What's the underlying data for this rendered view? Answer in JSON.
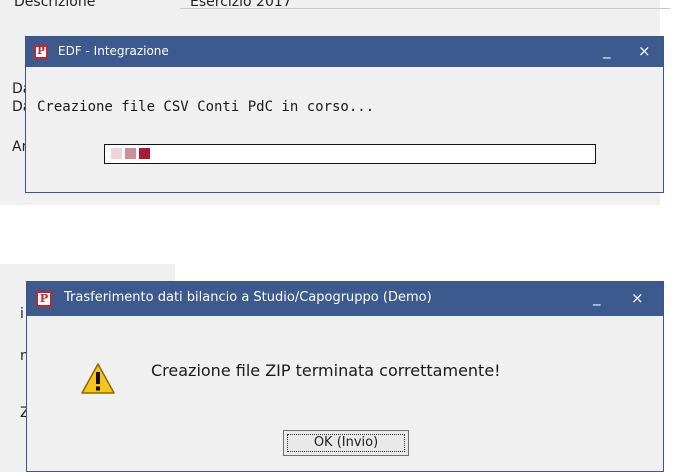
{
  "background": {
    "label_descrizione": "Descrizione",
    "value_descrizione": "Esercizio 2017",
    "fragments_top": [
      "Da",
      "Da",
      "An"
    ],
    "fragments_bottom": [
      "i",
      "n",
      "Z"
    ]
  },
  "dialog_progress": {
    "title": "EDF - Integrazione",
    "message": "Creazione file CSV Conti PdC in corso...",
    "progress_fraction": 0.12,
    "segment_colors": [
      "#f1d4d8",
      "#cf8f98",
      "#a61c35"
    ],
    "minimize": "_",
    "close": "×"
  },
  "dialog_done": {
    "title": "Trasferimento dati bilancio a Studio/Capogruppo  (Demo)",
    "message": "Creazione file ZIP terminata correttamente!",
    "ok_label": "OK (Invio)",
    "icon": "warning-icon",
    "minimize": "_",
    "close": "×"
  },
  "colors": {
    "titlebar": "#3c5a8e",
    "brand_red": "#c0262c",
    "dialog_bg": "#f0f0f0"
  }
}
